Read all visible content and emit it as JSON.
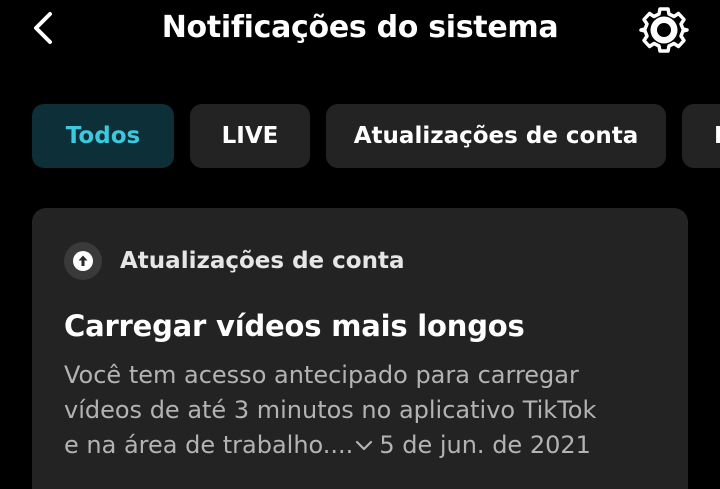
{
  "header": {
    "title": "Notificações do sistema",
    "back_icon": "chevron-left-icon",
    "settings_icon": "gear-icon"
  },
  "tabs": [
    {
      "label": "Todos",
      "selected": true
    },
    {
      "label": "LIVE",
      "selected": false
    },
    {
      "label": "Atualizações de conta",
      "selected": false
    },
    {
      "label": "N",
      "selected": false
    }
  ],
  "notification": {
    "category": "Atualizações de conta",
    "category_icon": "arrow-up-circle-icon",
    "title": "Carregar vídeos mais longos",
    "body_line1": "Você tem acesso antecipado para carregar",
    "body_line2": "vídeos de até 3 minutos no aplicativo TikTok",
    "body_line3": "e na área de trabalho....",
    "expand_icon": "chevron-down-icon",
    "date": "5 de jun. de 2021"
  },
  "colors": {
    "background": "#000000",
    "card": "#232323",
    "active_chip_bg": "#0d2f37",
    "active_chip_text": "#3cc9df",
    "muted_text": "#b3b3b3"
  }
}
